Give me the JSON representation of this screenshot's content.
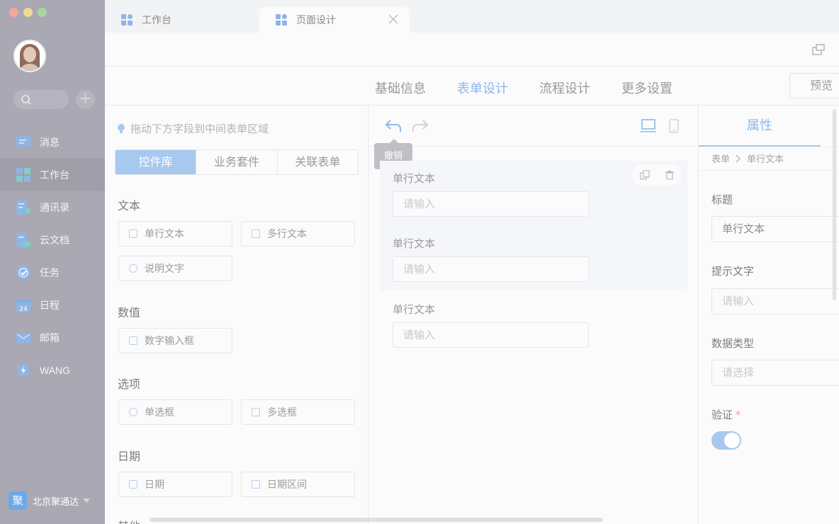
{
  "sidebar": {
    "items": [
      {
        "label": "消息",
        "icon": "message-icon"
      },
      {
        "label": "工作台",
        "icon": "workbench-icon"
      },
      {
        "label": "通讯录",
        "icon": "contacts-icon"
      },
      {
        "label": "云文档",
        "icon": "cloud-doc-icon"
      },
      {
        "label": "任务",
        "icon": "task-icon"
      },
      {
        "label": "日程",
        "icon": "calendar-icon"
      },
      {
        "label": "邮箱",
        "icon": "mail-icon"
      },
      {
        "label": "WANG",
        "icon": "wang-icon"
      }
    ],
    "active_index": 1,
    "company": {
      "logo_char": "聚",
      "name": "北京聚通达"
    }
  },
  "tabs": [
    {
      "label": "工作台"
    },
    {
      "label": "页面设计"
    }
  ],
  "steps": {
    "items": [
      "基础信息",
      "表单设计",
      "流程设计",
      "更多设置"
    ],
    "active_index": 1,
    "preview_label": "预览"
  },
  "left_panel": {
    "hint": "拖动下方字段到中间表单区域",
    "segments": [
      "控件库",
      "业务套件",
      "关联表单"
    ],
    "groups": [
      {
        "title": "文本",
        "fields": [
          "单行文本",
          "多行文本",
          "说明文字"
        ]
      },
      {
        "title": "数值",
        "fields": [
          "数字输入框"
        ]
      },
      {
        "title": "选项",
        "fields": [
          "单选框",
          "多选框"
        ]
      },
      {
        "title": "日期",
        "fields": [
          "日期",
          "日期区间"
        ]
      },
      {
        "title": "其他",
        "fields": []
      }
    ]
  },
  "center": {
    "tooltip": "撤销",
    "rows": [
      {
        "label": "单行文本",
        "placeholder": "请输入"
      },
      {
        "label": "单行文本",
        "placeholder": "请输入"
      },
      {
        "label": "单行文本",
        "placeholder": "请输入"
      }
    ]
  },
  "right_panel": {
    "tab": "属性",
    "breadcrumb": [
      "表单",
      "单行文本"
    ],
    "title_label": "标题",
    "title_value": "单行文本",
    "hint_label": "提示文字",
    "hint_placeholder": "请输入",
    "type_label": "数据类型",
    "type_placeholder": "请选择",
    "verify_label": "验证",
    "verify_required_mark": "*",
    "verify_on": true
  },
  "colors": {
    "accent": "#8bb8ec",
    "accent_fill": "#a7c8ef",
    "sidebar_bg": "#a9a8b3"
  }
}
